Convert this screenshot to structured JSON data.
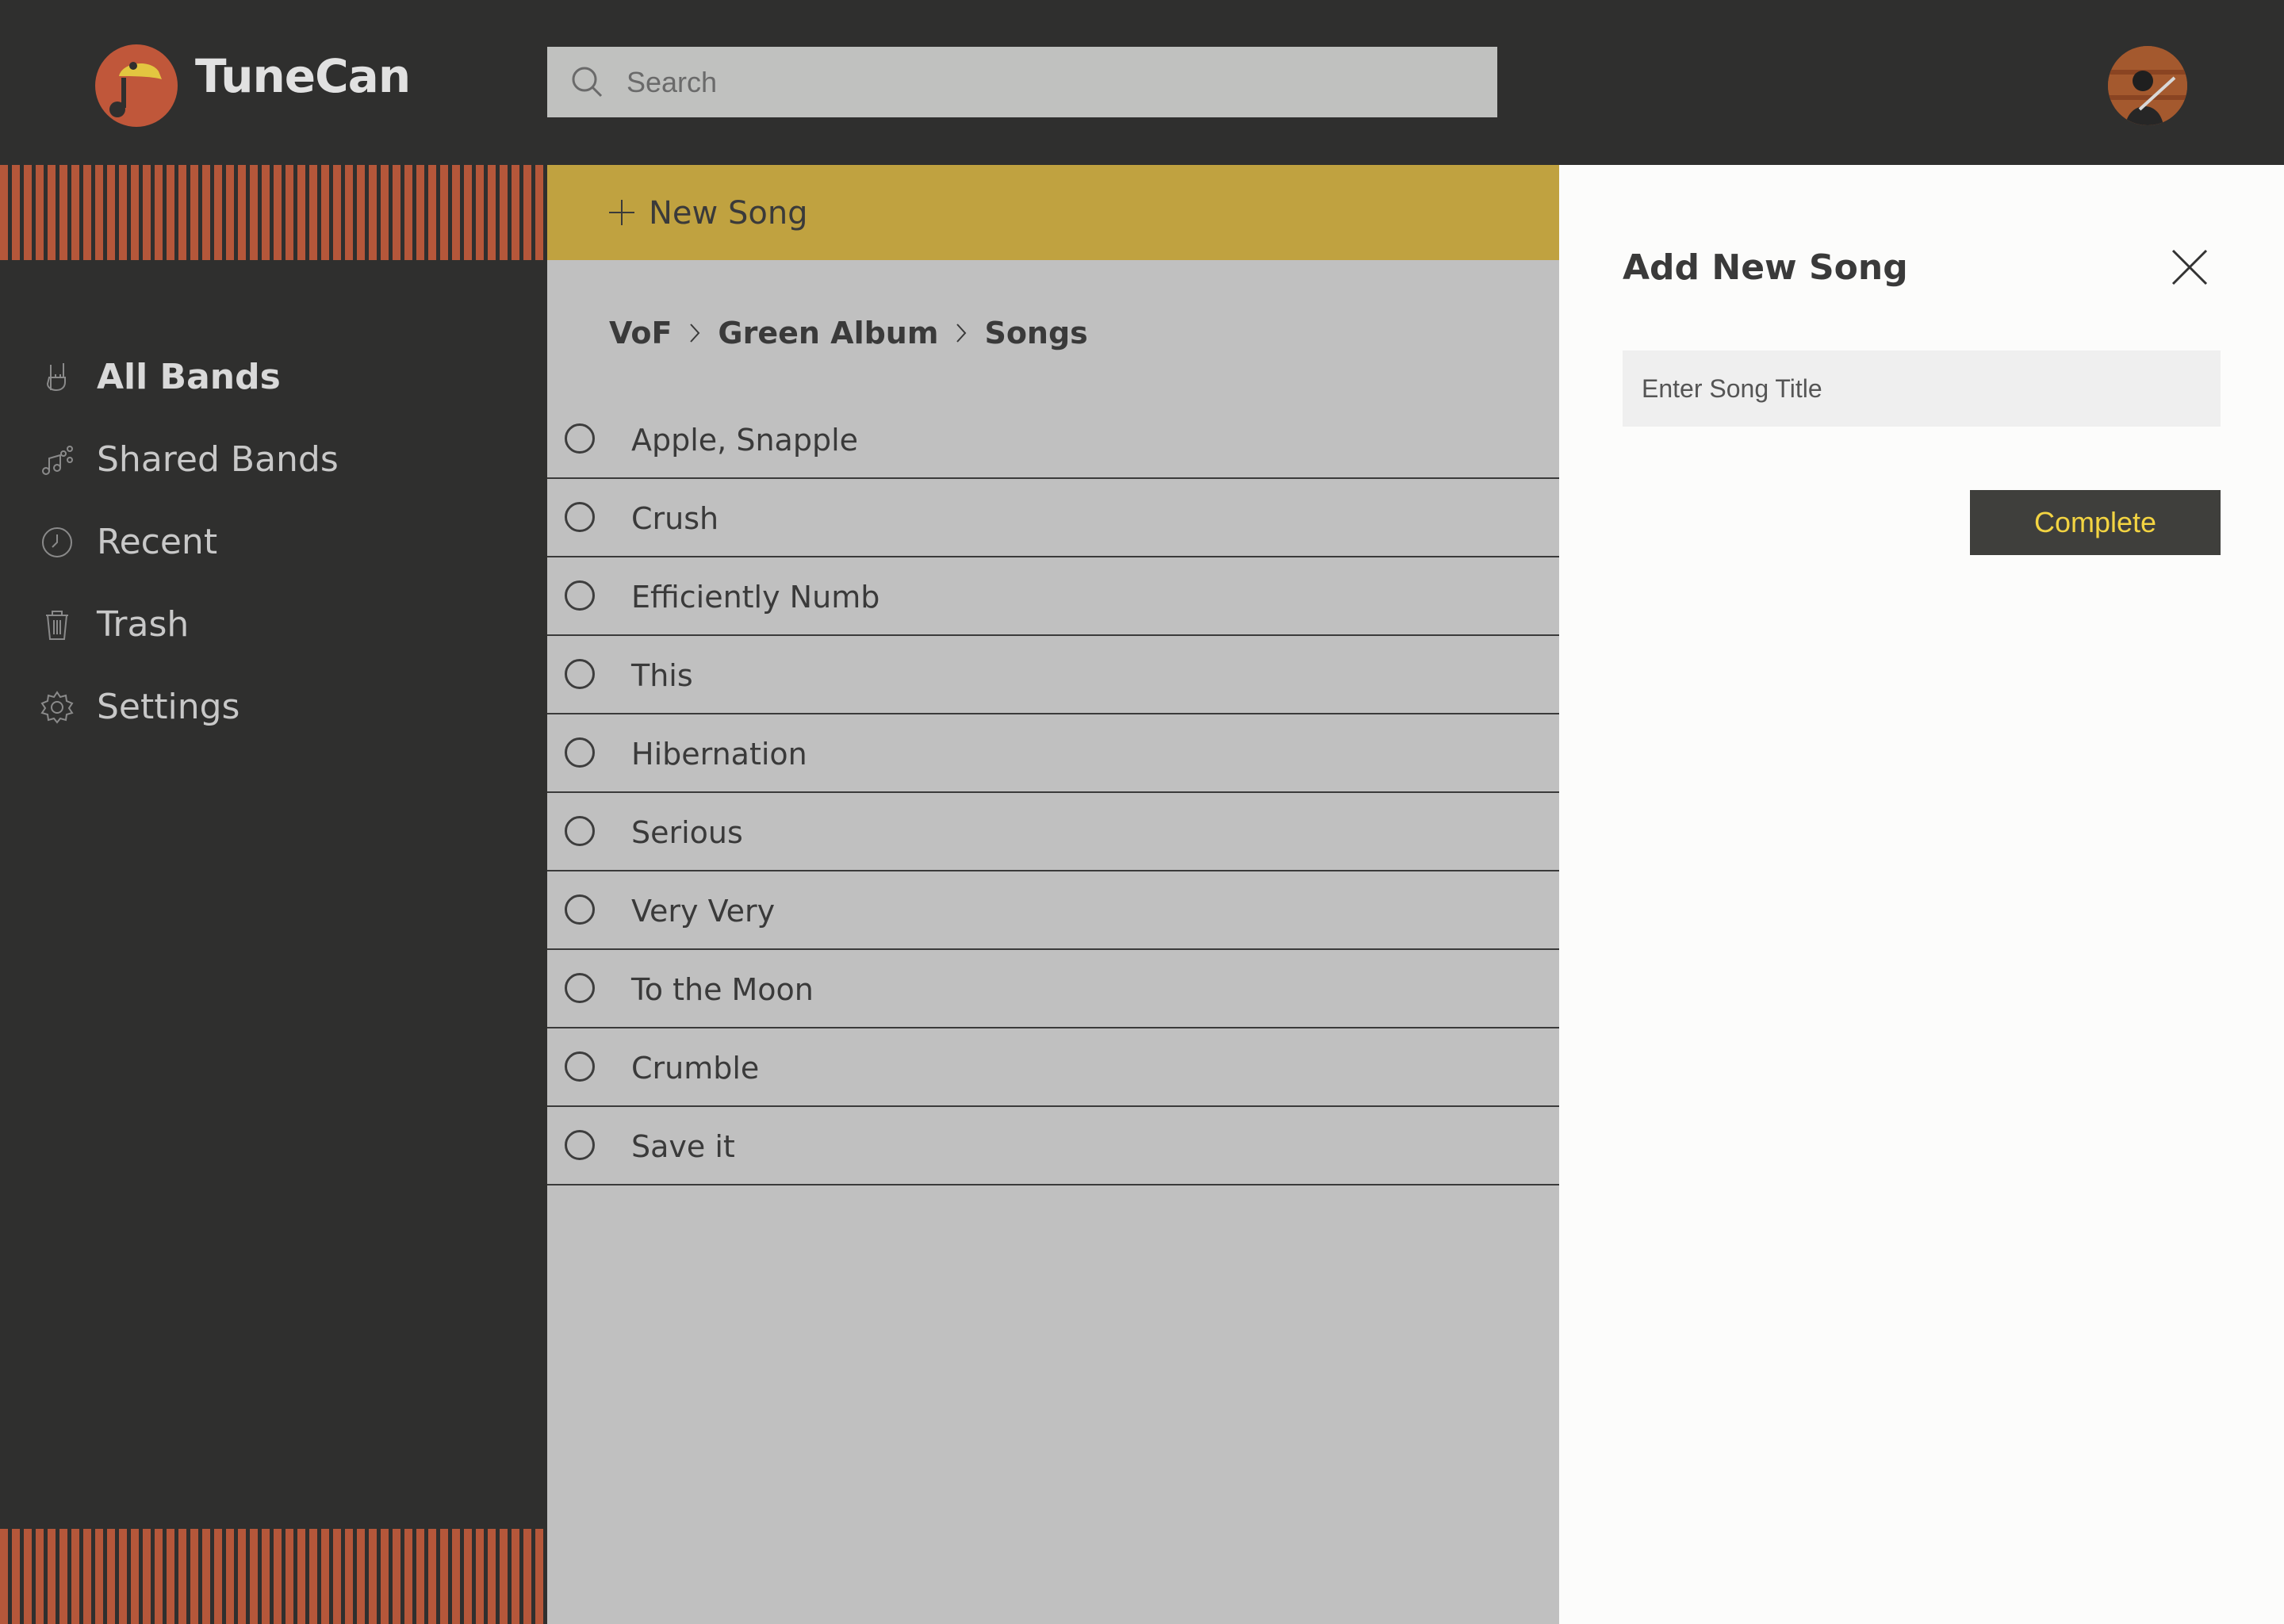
{
  "app": {
    "name": "TuneCan"
  },
  "search": {
    "placeholder": "Search"
  },
  "colors": {
    "topbar": "#2f2f2e",
    "accent_orange": "#c0573a",
    "new_song_bar": "#c0a240",
    "content_bg": "#c0c0c0",
    "complete_text": "#f3d442"
  },
  "sidebar": {
    "items": [
      {
        "label": "All Bands",
        "icon": "rock-hand-icon",
        "active": true
      },
      {
        "label": "Shared Bands",
        "icon": "shared-music-icon",
        "active": false
      },
      {
        "label": "Recent",
        "icon": "clock-icon",
        "active": false
      },
      {
        "label": "Trash",
        "icon": "trash-icon",
        "active": false
      },
      {
        "label": "Settings",
        "icon": "gear-icon",
        "active": false
      }
    ]
  },
  "toolbar": {
    "new_song_label": "New Song"
  },
  "breadcrumb": {
    "band": "VoF",
    "album": "Green Album",
    "section": "Songs"
  },
  "songs": [
    {
      "title": "Apple, Snapple"
    },
    {
      "title": "Crush"
    },
    {
      "title": "Efficiently Numb"
    },
    {
      "title": "This"
    },
    {
      "title": "Hibernation"
    },
    {
      "title": "Serious"
    },
    {
      "title": "Very Very"
    },
    {
      "title": "To the Moon"
    },
    {
      "title": "Crumble"
    },
    {
      "title": "Save it"
    }
  ],
  "panel": {
    "title": "Add New Song",
    "input_placeholder": "Enter Song Title",
    "complete_label": "Complete"
  }
}
